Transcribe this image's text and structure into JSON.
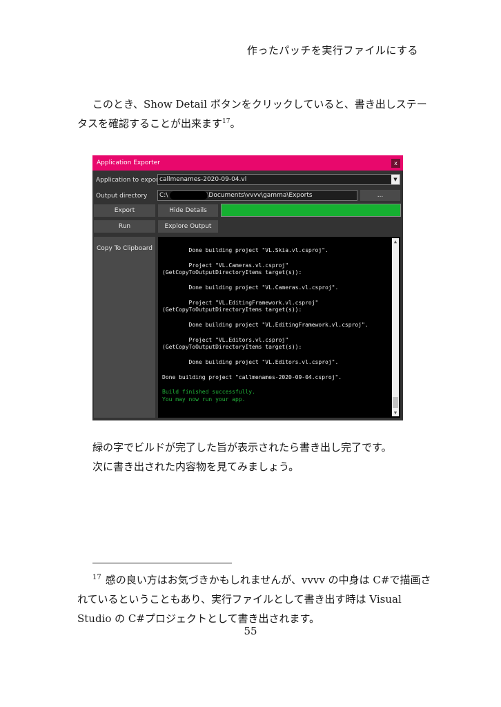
{
  "running_head": "作ったパッチを実行ファイルにする",
  "intro": {
    "line1": "このとき、Show Detail ボタンをクリックしていると、書き出しステー",
    "line2": "タスを確認することが出来ます",
    "footnote_ref": "17",
    "line2_end": "。"
  },
  "app_window": {
    "title": "Application Exporter",
    "close_label": "x",
    "app_to_export_label": "Application to export",
    "app_to_export_value": "callmenames-2020-09-04.vl",
    "output_dir_label": "Output directory",
    "output_dir_prefix": "C:\\",
    "output_dir_suffix": "\\Documents\\vvvv\\gamma\\Exports",
    "browse_label": "...",
    "export_label": "Export",
    "hide_details_label": "Hide Details",
    "run_label": "Run",
    "explore_output_label": "Explore Output",
    "copy_clipboard_label": "Copy To Clipboard",
    "progress": 1.0,
    "progress_color": "#16b031",
    "title_bar_color": "#e8086c",
    "console_lines": [
      {
        "text": "        Done building project \"VL.Skia.vl.csproj\".",
        "status": "normal"
      },
      {
        "text": "",
        "status": "normal"
      },
      {
        "text": "        Project \"VL.Cameras.vl.csproj\"",
        "status": "normal"
      },
      {
        "text": "(GetCopyToOutputDirectoryItems target(s)):",
        "status": "normal"
      },
      {
        "text": "",
        "status": "normal"
      },
      {
        "text": "        Done building project \"VL.Cameras.vl.csproj\".",
        "status": "normal"
      },
      {
        "text": "",
        "status": "normal"
      },
      {
        "text": "        Project \"VL.EditingFramework.vl.csproj\"",
        "status": "normal"
      },
      {
        "text": "(GetCopyToOutputDirectoryItems target(s)):",
        "status": "normal"
      },
      {
        "text": "",
        "status": "normal"
      },
      {
        "text": "        Done building project \"VL.EditingFramework.vl.csproj\".",
        "status": "normal"
      },
      {
        "text": "",
        "status": "normal"
      },
      {
        "text": "        Project \"VL.Editors.vl.csproj\"",
        "status": "normal"
      },
      {
        "text": "(GetCopyToOutputDirectoryItems target(s)):",
        "status": "normal"
      },
      {
        "text": "",
        "status": "normal"
      },
      {
        "text": "        Done building project \"VL.Editors.vl.csproj\".",
        "status": "normal"
      },
      {
        "text": "",
        "status": "normal"
      },
      {
        "text": "Done building project \"callmenames-2020-09-04.csproj\".",
        "status": "normal"
      },
      {
        "text": "",
        "status": "normal"
      },
      {
        "text": "Build finished successfully.",
        "status": "success"
      },
      {
        "text": "You may now run your app.",
        "status": "success"
      }
    ]
  },
  "outro": {
    "line1": "緑の字でビルドが完了した旨が表示されたら書き出し完了です。",
    "line2": "次に書き出された内容物を見てみましょう。"
  },
  "footnote": {
    "mark": "17",
    "line1": "感の良い方はお気づきかもしれませんが、vvvv の中身は C#で描画さ",
    "line2": "れているということもあり、実行ファイルとして書き出す時は Visual",
    "line3": "Studio の C#プロジェクトとして書き出されます。"
  },
  "page_number": "55"
}
